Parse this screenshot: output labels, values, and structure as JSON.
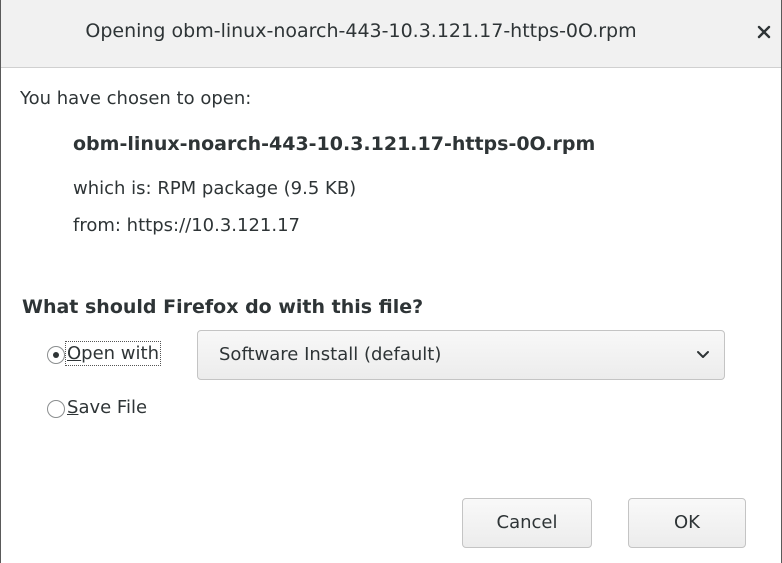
{
  "dialog": {
    "title": "Opening obm-linux-noarch-443-10.3.121.17-https-0O.rpm",
    "close_glyph": "×"
  },
  "info": {
    "intro": "You have chosen to open:",
    "filename": "obm-linux-noarch-443-10.3.121.17-https-0O.rpm",
    "which_is": "which is: RPM package (9.5 KB)",
    "from": "from: https://10.3.121.17"
  },
  "action": {
    "question": "What should Firefox do with this file?",
    "open_with": {
      "mnemonic": "O",
      "rest": "pen with",
      "selected": true
    },
    "open_with_app": "Software Install (default)",
    "save_file": {
      "mnemonic": "S",
      "rest": "ave File",
      "selected": false
    }
  },
  "buttons": {
    "cancel": "Cancel",
    "ok": "OK"
  },
  "icons": {
    "close": "close-icon",
    "dropdown": "chevron-down-icon"
  }
}
